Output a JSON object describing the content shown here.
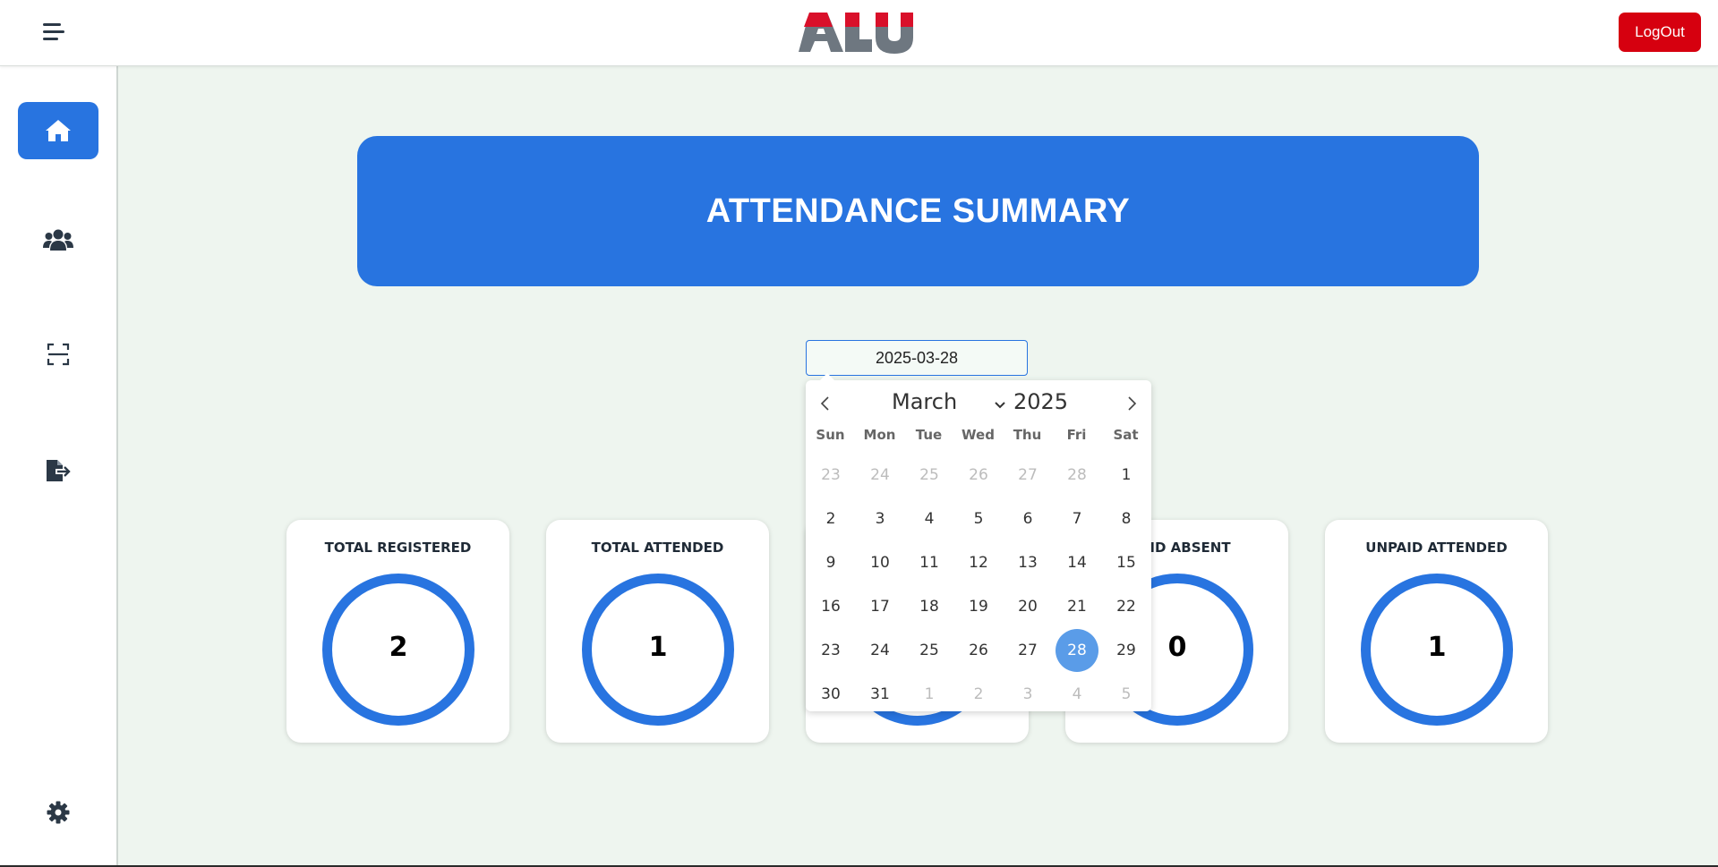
{
  "header": {
    "logo_text": "ALU",
    "logout_label": "LogOut"
  },
  "sidebar": {
    "items": [
      {
        "name": "home",
        "icon": "home-icon",
        "active": true
      },
      {
        "name": "users",
        "icon": "users-icon",
        "active": false
      },
      {
        "name": "scan",
        "icon": "scan-icon",
        "active": false
      },
      {
        "name": "export",
        "icon": "file-export-icon",
        "active": false
      },
      {
        "name": "settings",
        "icon": "gear-icon",
        "active": false
      }
    ]
  },
  "main": {
    "title": "ATTENDANCE SUMMARY",
    "date_value": "2025-03-28",
    "cards": [
      {
        "title": "TOTAL REGISTERED",
        "value": "2"
      },
      {
        "title": "TOTAL ATTENDED",
        "value": "1"
      },
      {
        "title": "",
        "value": ""
      },
      {
        "title": "ID ABSENT",
        "value": "0"
      },
      {
        "title": "UNPAID ATTENDED",
        "value": "1"
      }
    ]
  },
  "calendar": {
    "month": "March",
    "year": "2025",
    "weekdays": [
      "Sun",
      "Mon",
      "Tue",
      "Wed",
      "Thu",
      "Fri",
      "Sat"
    ],
    "days": [
      [
        "23",
        "24",
        "25",
        "26",
        "27",
        "28",
        "1"
      ],
      [
        "2",
        "3",
        "4",
        "5",
        "6",
        "7",
        "8"
      ],
      [
        "9",
        "10",
        "11",
        "12",
        "13",
        "14",
        "15"
      ],
      [
        "16",
        "17",
        "18",
        "19",
        "20",
        "21",
        "22"
      ],
      [
        "23",
        "24",
        "25",
        "26",
        "27",
        "28",
        "29"
      ],
      [
        "30",
        "31",
        "1",
        "2",
        "3",
        "4",
        "5"
      ]
    ],
    "selected_day": "28"
  },
  "colors": {
    "accent": "#2874e0",
    "logout": "#d6000f",
    "background": "#eef5ef",
    "logo_red": "#d9102a",
    "logo_gray": "#6e7780"
  }
}
